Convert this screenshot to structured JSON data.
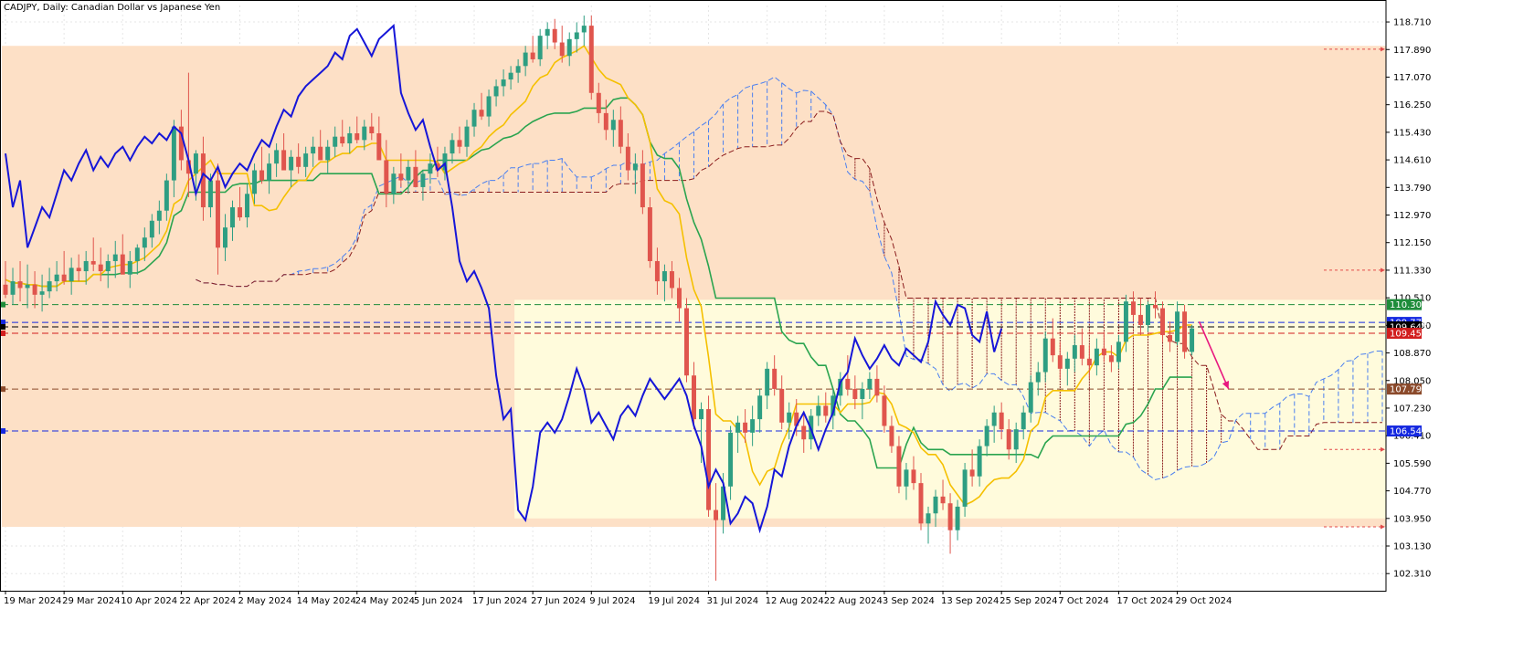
{
  "window": {
    "title": "CADJPY, Daily:  Canadian Dollar vs Japanese Yen"
  },
  "colors": {
    "background": "#ffffff",
    "grid": "#e6e6e6",
    "zone_peach": "#fde0c6",
    "zone_cream": "#fffbdc",
    "bull": "#2e9e82",
    "bear": "#e0554d",
    "tenkan": "#f5c000",
    "kijun": "#2aa44f",
    "chikou": "#1616d8",
    "kumo_bull": "#4a7ff0",
    "kumo_bear": "#8b1d1d",
    "level_green": "#1e8c3a",
    "level_blue": "#1428e0",
    "level_red": "#d21e1e",
    "level_brown": "#8b4a2b",
    "level_black": "#000000",
    "arrow": "#e8187f",
    "marker_red": "#e24a4a"
  },
  "chart_data": {
    "type": "candlestick",
    "symbol": "CADJPY",
    "timeframe": "Daily",
    "ylim": [
      101.8,
      119.2
    ],
    "y_ticks": [
      "118.710",
      "117.890",
      "117.070",
      "116.250",
      "115.430",
      "114.610",
      "113.790",
      "112.970",
      "112.150",
      "111.330",
      "110.510",
      "109.690",
      "108.870",
      "108.050",
      "107.230",
      "106.410",
      "105.590",
      "104.770",
      "103.950",
      "103.130",
      "102.310"
    ],
    "x_labels": [
      "19 Mar 2024",
      "29 Mar 2024",
      "10 Apr 2024",
      "22 Apr 2024",
      "2 May 2024",
      "14 May 2024",
      "24 May 2024",
      "5 Jun 2024",
      "17 Jun 2024",
      "27 Jun 2024",
      "9 Jul 2024",
      "19 Jul 2024",
      "31 Jul 2024",
      "12 Aug 2024",
      "22 Aug 2024",
      "3 Sep 2024",
      "13 Sep 2024",
      "25 Sep 2024",
      "7 Oct 2024",
      "17 Oct 2024",
      "29 Oct 2024"
    ],
    "x_label_index": [
      0,
      8,
      16,
      24,
      32,
      40,
      48,
      56,
      64,
      72,
      80,
      88,
      96,
      104,
      112,
      120,
      128,
      136,
      144,
      152,
      160
    ],
    "future_bars": 26,
    "ohlc": [
      [
        110.9,
        111.6,
        110.5,
        110.6
      ],
      [
        110.6,
        111.4,
        110.3,
        111.0
      ],
      [
        111.0,
        111.6,
        110.4,
        110.8
      ],
      [
        110.8,
        111.5,
        110.2,
        110.9
      ],
      [
        110.9,
        111.3,
        110.2,
        110.6
      ],
      [
        110.6,
        111.2,
        110.1,
        110.7
      ],
      [
        110.7,
        111.4,
        110.5,
        111.0
      ],
      [
        111.0,
        111.6,
        110.7,
        111.2
      ],
      [
        111.2,
        111.9,
        110.9,
        111.0
      ],
      [
        111.0,
        111.7,
        110.6,
        111.4
      ],
      [
        111.4,
        111.8,
        111.0,
        111.3
      ],
      [
        111.3,
        111.9,
        110.9,
        111.6
      ],
      [
        111.6,
        112.3,
        111.3,
        111.5
      ],
      [
        111.5,
        112.0,
        111.0,
        111.3
      ],
      [
        111.3,
        111.8,
        110.8,
        111.6
      ],
      [
        111.6,
        112.2,
        111.1,
        111.8
      ],
      [
        111.8,
        112.4,
        111.4,
        111.2
      ],
      [
        111.2,
        111.9,
        110.8,
        111.6
      ],
      [
        111.6,
        112.1,
        111.2,
        112.0
      ],
      [
        112.0,
        112.6,
        111.6,
        112.3
      ],
      [
        112.3,
        113.0,
        112.0,
        112.8
      ],
      [
        112.8,
        113.4,
        112.4,
        113.1
      ],
      [
        113.1,
        114.2,
        112.8,
        114.0
      ],
      [
        114.0,
        115.8,
        113.5,
        115.6
      ],
      [
        115.6,
        116.1,
        114.3,
        114.6
      ],
      [
        114.6,
        117.2,
        113.5,
        114.2
      ],
      [
        114.2,
        114.9,
        113.4,
        114.8
      ],
      [
        114.8,
        115.3,
        112.8,
        113.2
      ],
      [
        113.2,
        114.2,
        112.9,
        114.0
      ],
      [
        114.0,
        114.5,
        111.2,
        112.0
      ],
      [
        112.0,
        113.0,
        111.6,
        112.6
      ],
      [
        112.6,
        113.4,
        112.2,
        113.2
      ],
      [
        113.2,
        113.8,
        112.8,
        112.9
      ],
      [
        112.9,
        113.9,
        112.6,
        113.6
      ],
      [
        113.6,
        114.5,
        113.3,
        114.3
      ],
      [
        114.3,
        115.0,
        113.9,
        114.0
      ],
      [
        114.0,
        114.8,
        113.6,
        114.5
      ],
      [
        114.5,
        115.1,
        114.1,
        114.9
      ],
      [
        114.9,
        115.4,
        114.4,
        114.3
      ],
      [
        114.3,
        114.9,
        113.8,
        114.7
      ],
      [
        114.7,
        115.1,
        114.2,
        114.4
      ],
      [
        114.4,
        115.0,
        114.1,
        114.8
      ],
      [
        114.8,
        115.3,
        114.4,
        115.0
      ],
      [
        115.0,
        115.5,
        114.6,
        114.6
      ],
      [
        114.6,
        115.2,
        114.2,
        115.0
      ],
      [
        115.0,
        115.6,
        114.7,
        115.3
      ],
      [
        115.3,
        115.8,
        115.0,
        115.1
      ],
      [
        115.1,
        115.6,
        114.8,
        115.4
      ],
      [
        115.4,
        115.9,
        115.1,
        115.2
      ],
      [
        115.2,
        115.8,
        114.9,
        115.6
      ],
      [
        115.6,
        116.0,
        115.2,
        115.4
      ],
      [
        115.4,
        115.9,
        115.0,
        114.6
      ],
      [
        114.6,
        115.2,
        113.2,
        113.6
      ],
      [
        113.6,
        114.4,
        113.3,
        114.2
      ],
      [
        114.2,
        114.8,
        113.8,
        114.0
      ],
      [
        114.0,
        114.6,
        113.6,
        114.4
      ],
      [
        114.4,
        114.9,
        114.0,
        113.8
      ],
      [
        113.8,
        114.3,
        113.4,
        114.2
      ],
      [
        114.2,
        114.8,
        113.9,
        114.5
      ],
      [
        114.5,
        115.0,
        114.1,
        114.3
      ],
      [
        114.3,
        115.0,
        114.0,
        114.8
      ],
      [
        114.8,
        115.4,
        114.5,
        115.2
      ],
      [
        115.2,
        115.6,
        114.8,
        115.0
      ],
      [
        115.0,
        115.8,
        114.7,
        115.6
      ],
      [
        115.6,
        116.3,
        115.3,
        116.1
      ],
      [
        116.1,
        116.6,
        115.8,
        115.9
      ],
      [
        115.9,
        116.7,
        115.6,
        116.5
      ],
      [
        116.5,
        117.0,
        116.2,
        116.8
      ],
      [
        116.8,
        117.3,
        116.5,
        117.0
      ],
      [
        117.0,
        117.4,
        116.7,
        117.2
      ],
      [
        117.2,
        117.6,
        116.9,
        117.4
      ],
      [
        117.4,
        118.0,
        117.1,
        117.8
      ],
      [
        117.8,
        118.3,
        117.5,
        117.6
      ],
      [
        117.6,
        118.5,
        117.4,
        118.3
      ],
      [
        118.3,
        118.7,
        117.9,
        118.5
      ],
      [
        118.5,
        118.8,
        117.9,
        118.1
      ],
      [
        118.1,
        118.6,
        117.5,
        117.7
      ],
      [
        117.7,
        118.4,
        117.4,
        118.2
      ],
      [
        118.2,
        118.7,
        117.8,
        118.4
      ],
      [
        118.4,
        118.9,
        118.0,
        118.6
      ],
      [
        118.6,
        118.9,
        116.4,
        116.6
      ],
      [
        116.6,
        116.9,
        115.7,
        116.0
      ],
      [
        116.0,
        116.4,
        115.2,
        115.5
      ],
      [
        115.5,
        116.1,
        115.0,
        115.8
      ],
      [
        115.8,
        116.2,
        114.8,
        115.0
      ],
      [
        115.0,
        115.4,
        114.0,
        114.3
      ],
      [
        114.3,
        114.8,
        113.6,
        114.5
      ],
      [
        114.5,
        114.9,
        113.0,
        113.2
      ],
      [
        113.2,
        113.5,
        111.4,
        111.6
      ],
      [
        111.6,
        112.0,
        110.6,
        111.0
      ],
      [
        111.0,
        111.5,
        110.4,
        111.3
      ],
      [
        111.3,
        111.6,
        110.5,
        110.8
      ],
      [
        110.8,
        111.1,
        109.8,
        110.2
      ],
      [
        110.2,
        110.5,
        108.0,
        108.2
      ],
      [
        108.2,
        108.6,
        106.6,
        106.9
      ],
      [
        106.9,
        107.4,
        105.6,
        107.2
      ],
      [
        107.2,
        107.6,
        104.0,
        104.2
      ],
      [
        104.2,
        105.0,
        102.1,
        103.9
      ],
      [
        103.9,
        105.3,
        103.5,
        104.9
      ],
      [
        104.9,
        106.7,
        104.5,
        106.5
      ],
      [
        106.5,
        107.0,
        105.9,
        106.8
      ],
      [
        106.8,
        107.2,
        106.2,
        106.5
      ],
      [
        106.5,
        107.3,
        106.1,
        106.9
      ],
      [
        106.9,
        107.8,
        106.5,
        107.6
      ],
      [
        107.6,
        108.6,
        107.2,
        108.4
      ],
      [
        108.4,
        108.8,
        107.6,
        107.8
      ],
      [
        107.8,
        108.2,
        106.6,
        106.8
      ],
      [
        106.8,
        107.4,
        106.3,
        107.1
      ],
      [
        107.1,
        107.5,
        106.4,
        106.7
      ],
      [
        106.7,
        107.1,
        105.9,
        106.3
      ],
      [
        106.3,
        107.2,
        106.0,
        107.0
      ],
      [
        107.0,
        107.6,
        106.7,
        107.3
      ],
      [
        107.3,
        107.7,
        106.8,
        107.0
      ],
      [
        107.0,
        107.8,
        106.6,
        107.6
      ],
      [
        107.6,
        108.3,
        107.3,
        108.1
      ],
      [
        108.1,
        108.8,
        107.6,
        107.8
      ],
      [
        107.8,
        108.2,
        107.2,
        107.5
      ],
      [
        107.5,
        108.0,
        106.9,
        107.8
      ],
      [
        107.8,
        108.3,
        107.5,
        108.1
      ],
      [
        108.1,
        108.5,
        107.4,
        107.6
      ],
      [
        107.6,
        107.9,
        106.5,
        106.7
      ],
      [
        106.7,
        107.0,
        105.9,
        106.1
      ],
      [
        106.1,
        106.4,
        104.7,
        104.9
      ],
      [
        104.9,
        105.6,
        104.5,
        105.4
      ],
      [
        105.4,
        105.8,
        104.8,
        105.0
      ],
      [
        105.0,
        105.3,
        103.6,
        103.8
      ],
      [
        103.8,
        104.3,
        103.2,
        104.1
      ],
      [
        104.1,
        104.8,
        103.7,
        104.6
      ],
      [
        104.6,
        105.1,
        104.2,
        104.4
      ],
      [
        104.4,
        104.7,
        102.9,
        103.6
      ],
      [
        103.6,
        104.5,
        103.3,
        104.3
      ],
      [
        104.3,
        105.6,
        104.0,
        105.4
      ],
      [
        105.4,
        106.0,
        104.9,
        105.2
      ],
      [
        105.2,
        106.3,
        104.9,
        106.1
      ],
      [
        106.1,
        106.9,
        105.8,
        106.7
      ],
      [
        106.7,
        107.3,
        106.2,
        107.1
      ],
      [
        107.1,
        107.4,
        106.3,
        106.6
      ],
      [
        106.6,
        106.9,
        105.7,
        106.0
      ],
      [
        106.0,
        106.8,
        105.6,
        106.6
      ],
      [
        106.6,
        107.3,
        106.3,
        107.1
      ],
      [
        107.1,
        108.2,
        106.8,
        108.0
      ],
      [
        108.0,
        108.6,
        107.6,
        108.3
      ],
      [
        108.3,
        109.5,
        108.0,
        109.3
      ],
      [
        109.3,
        109.9,
        108.6,
        108.8
      ],
      [
        108.8,
        109.2,
        108.1,
        108.4
      ],
      [
        108.4,
        108.9,
        107.9,
        108.7
      ],
      [
        108.7,
        109.4,
        108.3,
        109.1
      ],
      [
        109.1,
        109.6,
        108.5,
        108.7
      ],
      [
        108.7,
        109.1,
        108.1,
        108.5
      ],
      [
        108.5,
        109.3,
        108.2,
        109.0
      ],
      [
        109.0,
        109.5,
        108.6,
        108.8
      ],
      [
        108.8,
        109.1,
        108.3,
        108.6
      ],
      [
        108.6,
        109.4,
        108.4,
        109.2
      ],
      [
        109.2,
        110.6,
        108.9,
        110.4
      ],
      [
        110.4,
        110.7,
        109.8,
        110.0
      ],
      [
        110.0,
        110.5,
        109.4,
        109.7
      ],
      [
        109.7,
        110.4,
        109.5,
        110.3
      ],
      [
        110.3,
        110.7,
        109.9,
        110.2
      ],
      [
        110.2,
        110.4,
        109.2,
        109.4
      ],
      [
        109.4,
        109.8,
        108.9,
        109.2
      ],
      [
        109.2,
        110.4,
        109.1,
        110.1
      ],
      [
        110.1,
        110.3,
        108.7,
        108.9
      ],
      [
        108.9,
        109.7,
        108.8,
        109.6
      ]
    ],
    "zones": [
      {
        "from_index": 0,
        "to_index": 186,
        "top": 118.0,
        "bottom": 103.7,
        "color": "zone_peach"
      },
      {
        "from_index": 70,
        "to_index": 186,
        "top": 110.45,
        "bottom": 103.95,
        "color": "zone_cream"
      }
    ],
    "levels": [
      {
        "value": 110.307,
        "label": "110.307",
        "color": "level_green"
      },
      {
        "value": 109.778,
        "label": "109.778",
        "color": "level_blue"
      },
      {
        "value": 109.645,
        "label": "109.645",
        "color": "level_black"
      },
      {
        "value": 109.454,
        "label": "109.454",
        "color": "level_red"
      },
      {
        "value": 107.795,
        "label": "107.795",
        "color": "level_brown"
      },
      {
        "value": 106.549,
        "label": "106.549",
        "color": "level_blue"
      }
    ],
    "arrow": {
      "from": [
        163,
        109.8
      ],
      "to": [
        167,
        107.8
      ]
    }
  }
}
